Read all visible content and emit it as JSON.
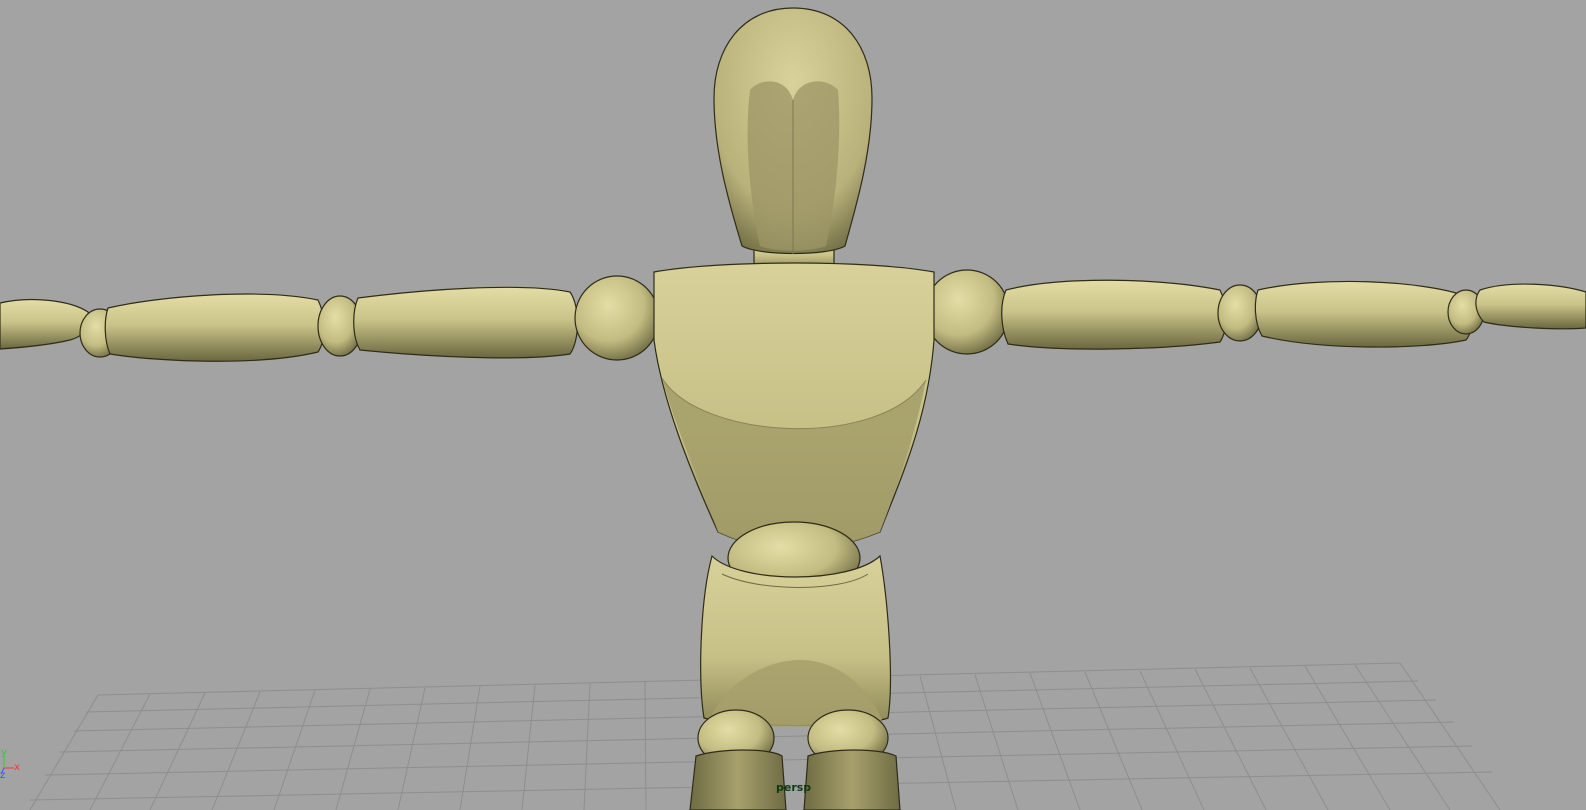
{
  "viewport": {
    "camera": "persp",
    "background_color": "#a3a3a3",
    "grid_color": "#8e8e8e",
    "model_color": "#c9c388"
  },
  "model": {
    "name": "wooden-mannequin",
    "pose": "T-pose"
  },
  "axis_gizmo": {
    "x_label": "x",
    "y_label": "y",
    "z_label": "z",
    "x_color": "#ff3333",
    "y_color": "#33cc33",
    "z_color": "#3355ff"
  }
}
